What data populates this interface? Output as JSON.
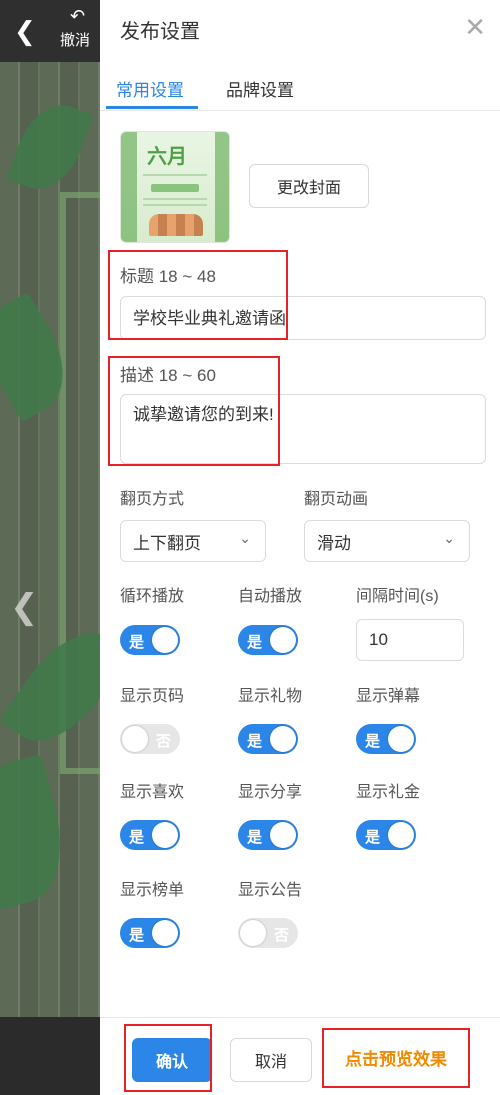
{
  "topbar": {
    "undo_label": "撤消"
  },
  "panel": {
    "title": "发布设置"
  },
  "tabs": [
    {
      "label": "常用设置",
      "active": true
    },
    {
      "label": "品牌设置",
      "active": false
    }
  ],
  "cover": {
    "change_button": "更改封面"
  },
  "title_field": {
    "label": "标题 18 ~ 48",
    "value": "学校毕业典礼邀请函"
  },
  "desc_field": {
    "label": "描述 18 ~ 60",
    "value": "诚挚邀请您的到来!"
  },
  "paging": {
    "mode_label": "翻页方式",
    "mode_value": "上下翻页",
    "anim_label": "翻页动画",
    "anim_value": "滑动"
  },
  "options": {
    "loop": {
      "label": "循环播放",
      "state": "是"
    },
    "autoplay": {
      "label": "自动播放",
      "state": "是"
    },
    "interval": {
      "label": "间隔时间(s)",
      "value": "10"
    },
    "page_num": {
      "label": "显示页码",
      "state": "否"
    },
    "gifts": {
      "label": "显示礼物",
      "state": "是"
    },
    "danmaku": {
      "label": "显示弹幕",
      "state": "是"
    },
    "likes": {
      "label": "显示喜欢",
      "state": "是"
    },
    "share": {
      "label": "显示分享",
      "state": "是"
    },
    "money": {
      "label": "显示礼金",
      "state": "是"
    },
    "ranking": {
      "label": "显示榜单",
      "state": "是"
    },
    "notice": {
      "label": "显示公告",
      "state": "否"
    }
  },
  "footer": {
    "confirm": "确认",
    "cancel": "取消",
    "preview": "点击预览效果"
  },
  "colors": {
    "accent": "#2b86e8",
    "highlight": "#e5222a",
    "preview": "#f08a00"
  }
}
